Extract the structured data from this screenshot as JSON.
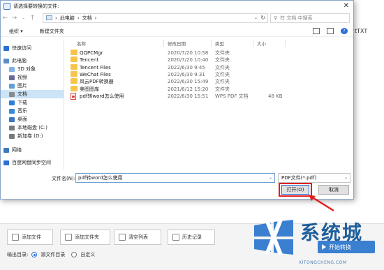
{
  "background": {
    "right_label": "tTXT",
    "buttons": [
      {
        "label": "添加文件",
        "icon": "add-file-icon"
      },
      {
        "label": "添加文件夹",
        "icon": "add-folder-icon"
      },
      {
        "label": "清空列表",
        "icon": "clear-list-icon"
      },
      {
        "label": "历史记录",
        "icon": "history-icon"
      }
    ],
    "output_label": "输出目录:",
    "output_options": [
      {
        "label": "源文件目录",
        "selected": true
      },
      {
        "label": "自定义",
        "selected": false
      }
    ],
    "start_button": "开始转换",
    "watermark": {
      "title": "系统城",
      "subtitle": "XITONGCHENG.COM",
      "colors": {
        "brand": "#1f5f9b"
      }
    }
  },
  "dialog": {
    "title": "请选择要转换的文件:",
    "breadcrumb": [
      "此电脑",
      "文档"
    ],
    "search_placeholder": "在 文档 中搜索",
    "toolbar": {
      "organize": "组织 ▾",
      "new_folder": "新建文件夹"
    },
    "nav_items": [
      {
        "label": "快速访问",
        "icon": "star-icon",
        "color": "#2b6fd6"
      },
      {
        "label": "此电脑",
        "icon": "computer-icon",
        "color": "#5a8cc8"
      },
      {
        "label": "3D 对象",
        "icon": "3d-objects-icon",
        "color": "#7fb3e6"
      },
      {
        "label": "视频",
        "icon": "video-icon",
        "color": "#6a6a9a"
      },
      {
        "label": "图片",
        "icon": "pictures-icon",
        "color": "#5fa0d8"
      },
      {
        "label": "文档",
        "icon": "documents-icon",
        "color": "#8a8a8a",
        "selected": true
      },
      {
        "label": "下载",
        "icon": "download-icon",
        "color": "#2b7fd6"
      },
      {
        "label": "音乐",
        "icon": "music-icon",
        "color": "#3a8ad8"
      },
      {
        "label": "桌面",
        "icon": "desktop-icon",
        "color": "#3b78c2"
      },
      {
        "label": "本地磁盘 (C:)",
        "icon": "drive-icon",
        "color": "#7a7a7a"
      },
      {
        "label": "新加卷 (D:)",
        "icon": "drive-icon",
        "color": "#7a7a7a"
      },
      {
        "label": "网络",
        "icon": "network-icon",
        "color": "#3b78c2"
      },
      {
        "label": "百度网盘同步空间",
        "icon": "cloud-icon",
        "color": "#2b6fd6"
      }
    ],
    "columns": [
      "名称",
      "修改日期",
      "类型",
      "大小"
    ],
    "files": [
      {
        "name": "QQPCMgr",
        "date": "2020/7/20 10:58",
        "type": "文件夹",
        "size": "",
        "kind": "folder"
      },
      {
        "name": "Tencent",
        "date": "2020/7/20 10:40",
        "type": "文件夹",
        "size": "",
        "kind": "folder"
      },
      {
        "name": "Tencent Files",
        "date": "2022/6/30 9:45",
        "type": "文件夹",
        "size": "",
        "kind": "folder"
      },
      {
        "name": "WeChat Files",
        "date": "2022/6/30 9:31",
        "type": "文件夹",
        "size": "",
        "kind": "folder"
      },
      {
        "name": "风云PDF转换器",
        "date": "2022/6/30 15:49",
        "type": "文件夹",
        "size": "",
        "kind": "folder"
      },
      {
        "name": "美图图库",
        "date": "2021/6/12 15:20",
        "type": "文件夹",
        "size": "",
        "kind": "folder"
      },
      {
        "name": "pdf转word怎么使用",
        "date": "2022/6/30 15:51",
        "type": "WPS PDF 文档",
        "size": "48 KB",
        "kind": "pdf"
      }
    ],
    "filename_label": "文件名(N):",
    "filename_value": "pdf转word怎么使用",
    "filetype_value": "PDF文件(*.pdf)",
    "open_button": "打开(O)",
    "cancel_button": "取消",
    "highlight_color": "#e12020"
  }
}
